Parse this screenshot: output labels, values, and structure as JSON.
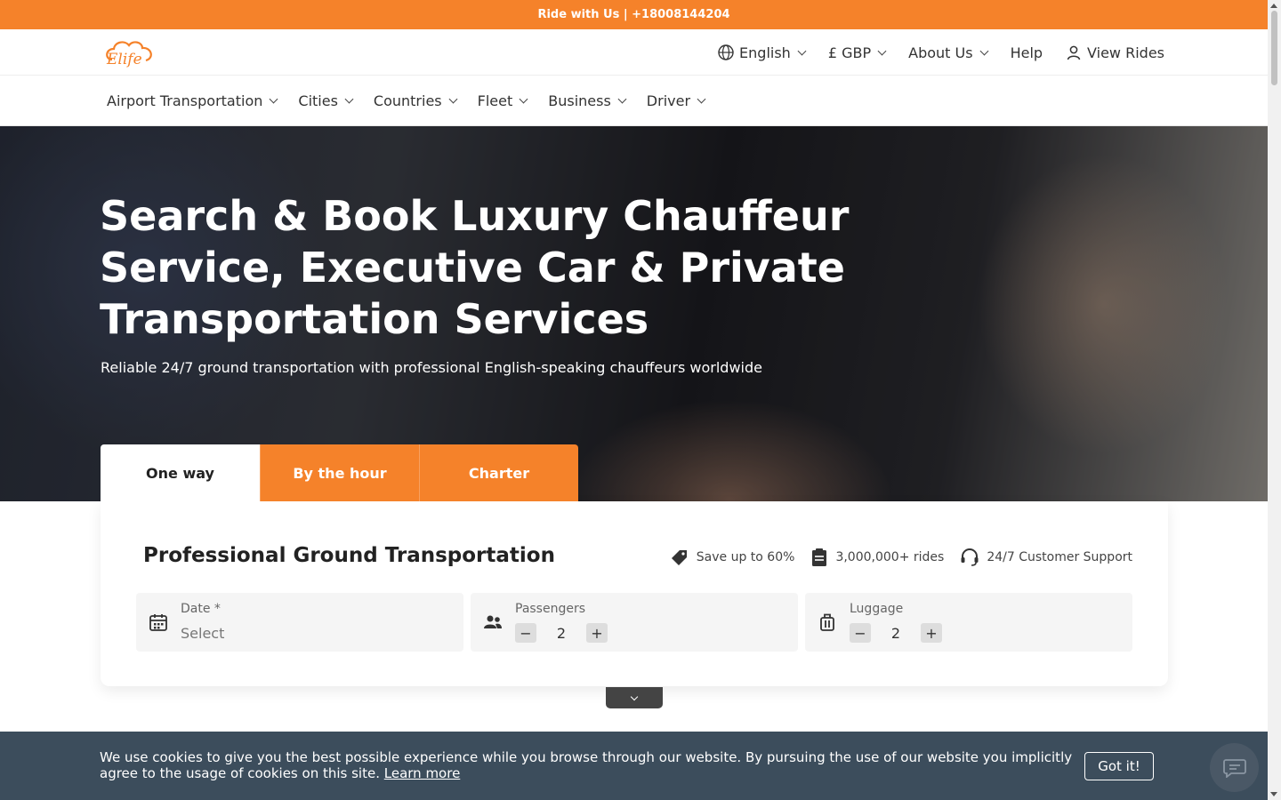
{
  "topbar": {
    "text": "Ride with Us | +18008144204"
  },
  "header": {
    "logo_text": "Elife",
    "language": "English",
    "currency": "£ GBP",
    "about": "About Us",
    "help": "Help",
    "view_rides": "View Rides"
  },
  "nav": {
    "items": [
      {
        "label": "Airport Transportation"
      },
      {
        "label": "Cities"
      },
      {
        "label": "Countries"
      },
      {
        "label": "Fleet"
      },
      {
        "label": "Business"
      },
      {
        "label": "Driver"
      }
    ]
  },
  "hero": {
    "title": "Search & Book Luxury Chauffeur Service, Executive Car & Private Transportation Services",
    "subtitle": "Reliable 24/7 ground transportation with professional English-speaking chauffeurs worldwide"
  },
  "tabs": [
    {
      "label": "One way",
      "active": true
    },
    {
      "label": "By the hour",
      "active": false
    },
    {
      "label": "Charter",
      "active": false
    }
  ],
  "booking": {
    "title": "Professional Ground Transportation",
    "features": [
      {
        "icon": "tag-icon",
        "text": "Save up to 60%"
      },
      {
        "icon": "clipboard-icon",
        "text": "3,000,000+ rides"
      },
      {
        "icon": "headset-icon",
        "text": "24/7 Customer Support"
      }
    ],
    "date": {
      "label": "Date *",
      "placeholder": "Select"
    },
    "passengers": {
      "label": "Passengers",
      "value": "2",
      "minus": "−",
      "plus": "+"
    },
    "luggage": {
      "label": "Luggage",
      "value": "2",
      "minus": "−",
      "plus": "+"
    }
  },
  "cookie": {
    "text": "We use cookies to give you the best possible experience while you browse through our website. By pursuing the use of our website you implicitly agree to the usage of cookies on this site.",
    "link": "Learn more",
    "button": "Got it!"
  },
  "colors": {
    "accent": "#f5822a",
    "cookie_bg": "#3c4d5c"
  }
}
